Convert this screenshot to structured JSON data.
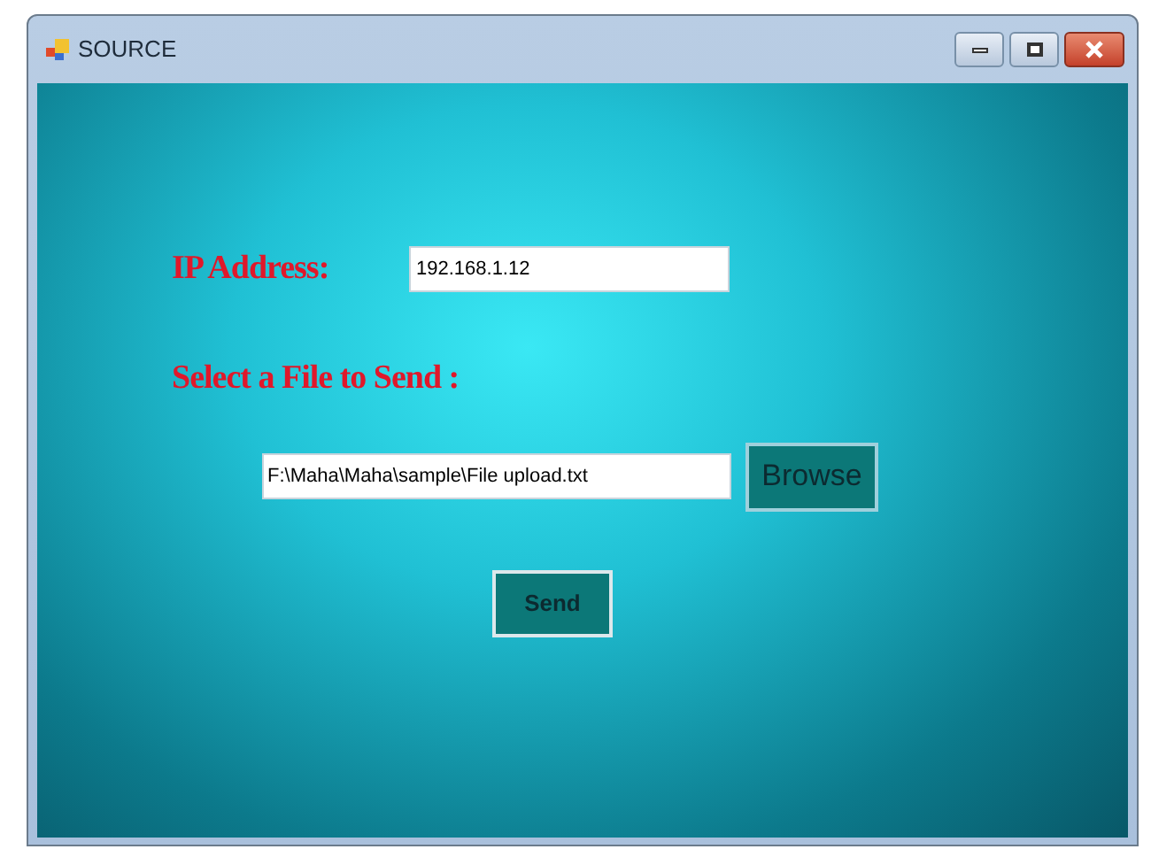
{
  "window": {
    "title": "SOURCE"
  },
  "ip": {
    "label": "IP Address:",
    "value": "192.168.1.12"
  },
  "file": {
    "label": "Select a File to Send :",
    "value": "F:\\Maha\\Maha\\sample\\File upload.txt",
    "browse": "Browse"
  },
  "send": {
    "label": "Send"
  }
}
